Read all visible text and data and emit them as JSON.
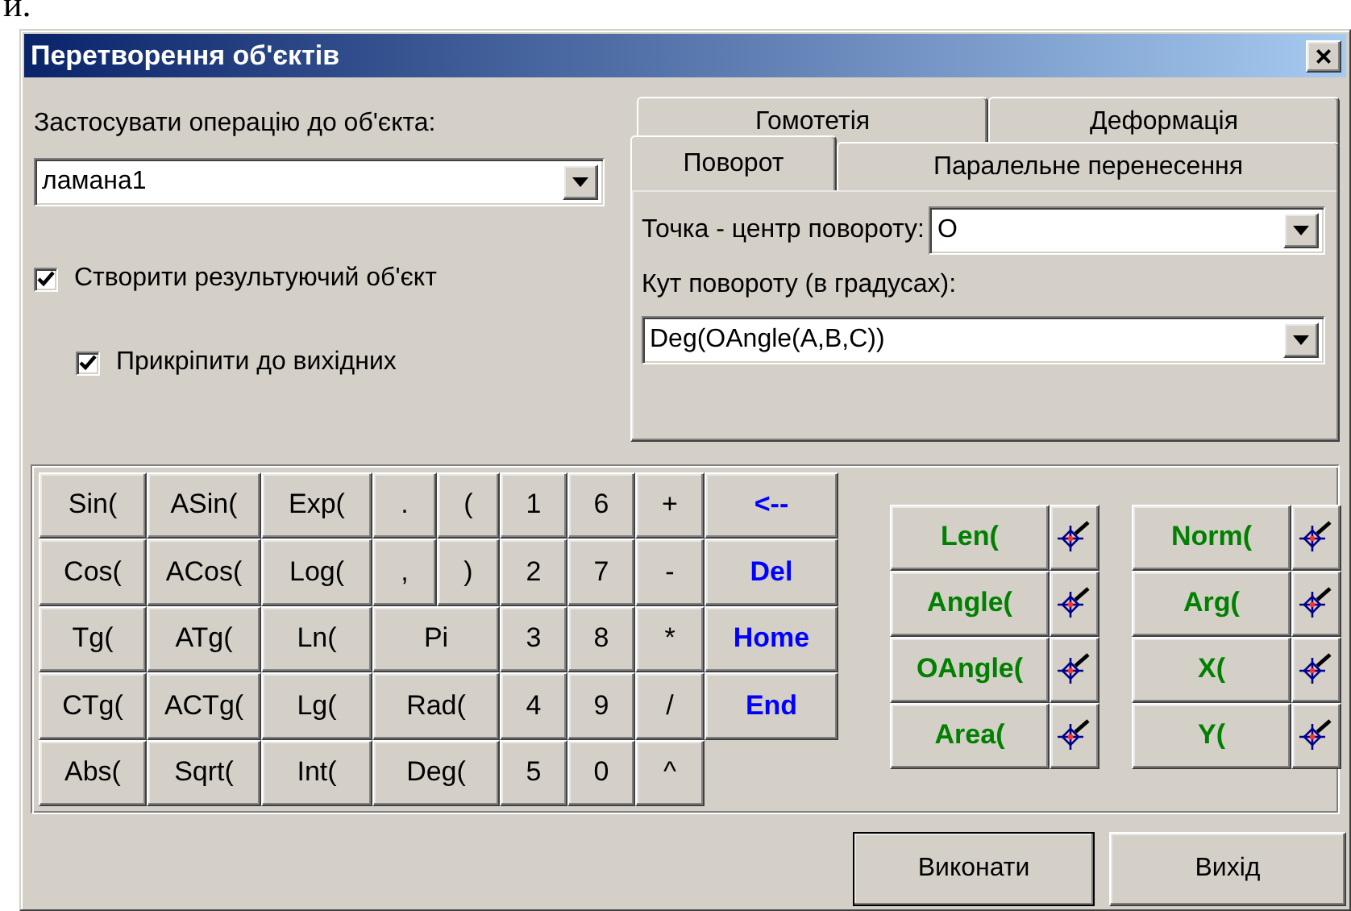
{
  "page_fragment": "и.",
  "window": {
    "title": "Перетворення об'єктів",
    "close": "×"
  },
  "target": {
    "label": "Застосувати операцію до об'єкта:",
    "value": "ламана1"
  },
  "options": [
    {
      "label": "Створити результуючий об'єкт",
      "checked": true,
      "kind": "main"
    },
    {
      "label": "Прикріпити до вихідних",
      "checked": true,
      "kind": "sub"
    }
  ],
  "tab_rows": [
    [
      {
        "label": "Гомотетія",
        "selected": false
      },
      {
        "label": "Деформація",
        "selected": false
      }
    ],
    [
      {
        "label": "Поворот",
        "selected": true
      },
      {
        "label": "Паралельне перенесення",
        "selected": false
      }
    ]
  ],
  "rotation": {
    "center_label": "Точка - центр повороту:",
    "center_value": "O",
    "angle_label": "Кут повороту (в градусах):",
    "angle_value": "Deg(OAngle(A,B,C))"
  },
  "keys": [
    {
      "label": "Sin(",
      "kind": "key"
    },
    {
      "label": "ASin(",
      "kind": "key"
    },
    {
      "label": "Exp(",
      "kind": "key"
    },
    {
      "label": ".",
      "kind": "key"
    },
    {
      "label": "(",
      "kind": "key"
    },
    {
      "label": "1",
      "kind": "key"
    },
    {
      "label": "6",
      "kind": "key"
    },
    {
      "label": "+",
      "kind": "key"
    },
    {
      "label": "<--",
      "kind": "edit"
    },
    {
      "label": "Cos(",
      "kind": "key"
    },
    {
      "label": "ACos(",
      "kind": "key"
    },
    {
      "label": "Log(",
      "kind": "key"
    },
    {
      "label": ",",
      "kind": "key"
    },
    {
      "label": ")",
      "kind": "key"
    },
    {
      "label": "2",
      "kind": "key"
    },
    {
      "label": "7",
      "kind": "key"
    },
    {
      "label": "-",
      "kind": "key"
    },
    {
      "label": "Del",
      "kind": "edit"
    },
    {
      "label": "Tg(",
      "kind": "key"
    },
    {
      "label": "ATg(",
      "kind": "key"
    },
    {
      "label": "Ln(",
      "kind": "key"
    },
    {
      "label": "Pi",
      "kind": "wide"
    },
    {
      "label": "3",
      "kind": "key"
    },
    {
      "label": "8",
      "kind": "key"
    },
    {
      "label": "*",
      "kind": "key"
    },
    {
      "label": "Home",
      "kind": "edit"
    },
    {
      "label": "CTg(",
      "kind": "key"
    },
    {
      "label": "ACTg(",
      "kind": "key"
    },
    {
      "label": "Lg(",
      "kind": "key"
    },
    {
      "label": "Rad(",
      "kind": "wide"
    },
    {
      "label": "4",
      "kind": "key"
    },
    {
      "label": "9",
      "kind": "key"
    },
    {
      "label": "/",
      "kind": "key"
    },
    {
      "label": "End",
      "kind": "edit"
    },
    {
      "label": "Abs(",
      "kind": "key"
    },
    {
      "label": "Sqrt(",
      "kind": "key"
    },
    {
      "label": "Int(",
      "kind": "key"
    },
    {
      "label": "Deg(",
      "kind": "wide"
    },
    {
      "label": "5",
      "kind": "key"
    },
    {
      "label": "0",
      "kind": "key"
    },
    {
      "label": "^",
      "kind": "key"
    }
  ],
  "measure_columns": [
    [
      "Len(",
      "Angle(",
      "OAngle(",
      "Area("
    ],
    [
      "Norm(",
      "Arg(",
      "X(",
      "Y("
    ]
  ],
  "buttons": [
    {
      "label": "Виконати",
      "kind": "default"
    },
    {
      "label": "Вихід",
      "kind": "normal"
    }
  ]
}
